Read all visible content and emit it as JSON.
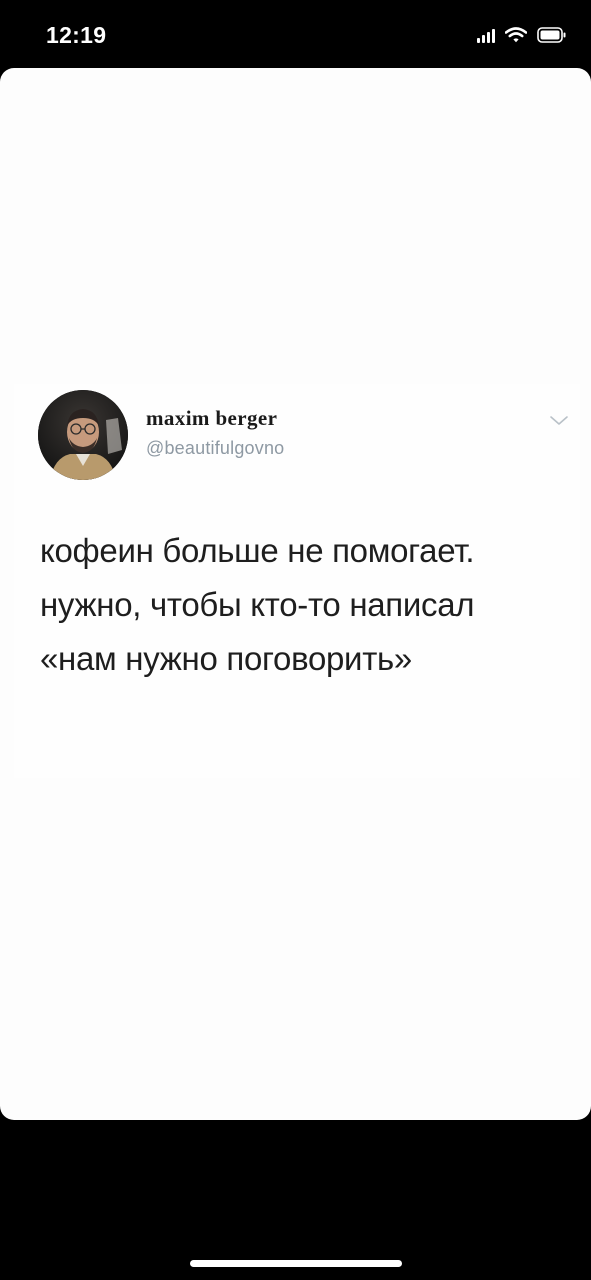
{
  "status_bar": {
    "time": "12:19",
    "icons": [
      "signal-icon",
      "wifi-icon",
      "battery-icon"
    ]
  },
  "tweet": {
    "author_name": "maxim berger",
    "author_handle": "@beautifulgovno",
    "text_lines": [
      "кофеин больше не помогает.",
      "нужно, чтобы кто-то написал",
      "«нам нужно поговорить»"
    ],
    "menu_icon": "chevron-down-icon"
  },
  "colors": {
    "background": "#000000",
    "card": "#fdfdfd",
    "name": "#1a1a1a",
    "handle": "#8e99a3",
    "text": "#1e1e1e"
  }
}
